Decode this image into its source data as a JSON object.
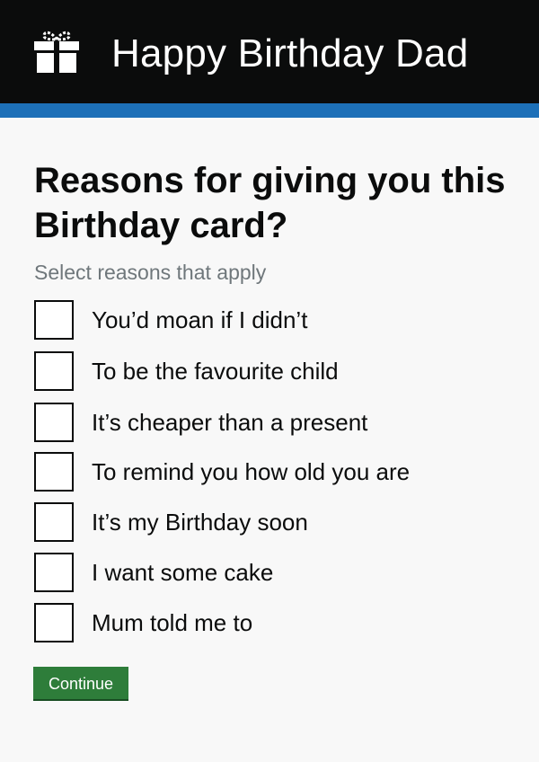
{
  "header": {
    "icon": "gift-icon",
    "title": "Happy Birthday Dad",
    "background_color": "#0b0c0c",
    "stripe_color": "#1d70b8"
  },
  "form": {
    "question": "Reasons for giving you this Birthday card?",
    "hint": "Select reasons that apply",
    "options": [
      {
        "label": "You’d moan if I didn’t",
        "checked": false
      },
      {
        "label": "To be the favourite child",
        "checked": false
      },
      {
        "label": "It’s cheaper than a present",
        "checked": false
      },
      {
        "label": "To remind you how old you are",
        "checked": false
      },
      {
        "label": "It’s my Birthday soon",
        "checked": false
      },
      {
        "label": "I want some cake",
        "checked": false
      },
      {
        "label": "Mum told me to",
        "checked": false
      }
    ],
    "continue_label": "Continue",
    "continue_color": "#2e7d3a"
  }
}
